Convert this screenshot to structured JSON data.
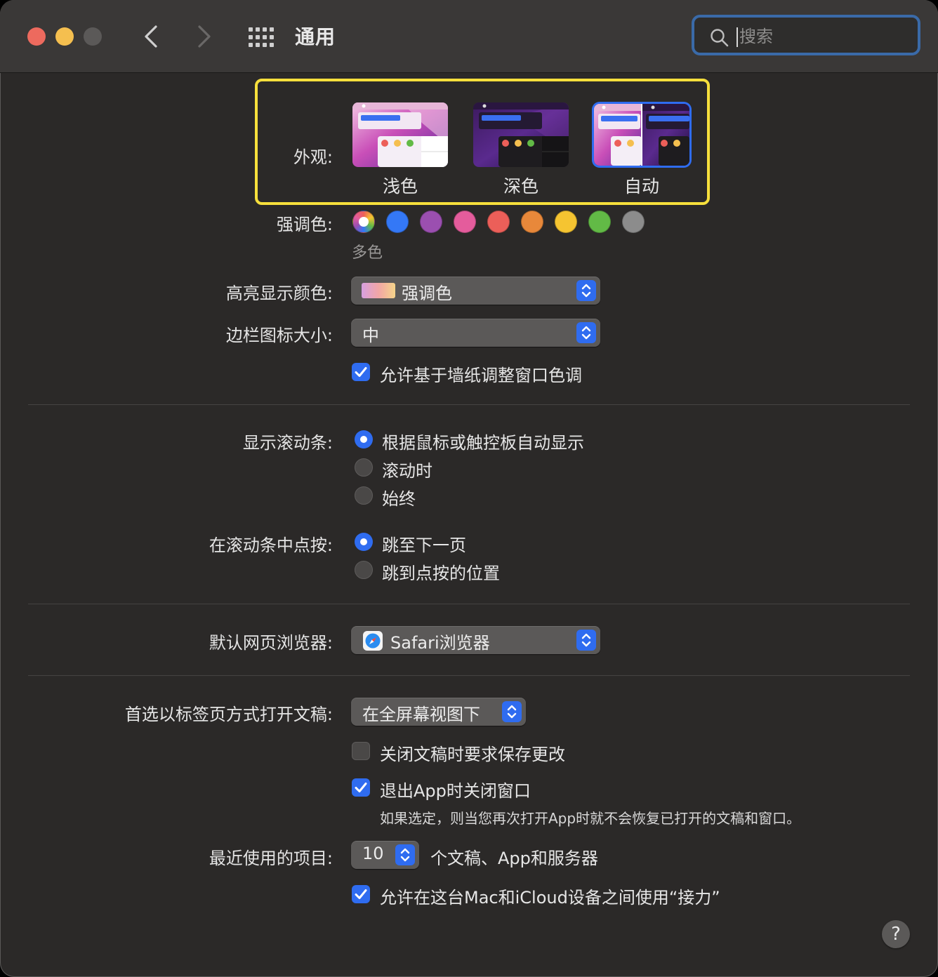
{
  "window": {
    "title": "通用"
  },
  "search": {
    "placeholder": "搜索",
    "value": ""
  },
  "appearance": {
    "label": "外观:",
    "options": [
      {
        "label": "浅色",
        "selected": false
      },
      {
        "label": "深色",
        "selected": false
      },
      {
        "label": "自动",
        "selected": true
      }
    ]
  },
  "accent": {
    "label": "强调色:",
    "selected_name": "多色",
    "colors": [
      "multicolor",
      "#3478f6",
      "#9b4fb0",
      "#e45c9c",
      "#ec5f59",
      "#e8883a",
      "#f5c431",
      "#62ba46",
      "#8c8c8c"
    ]
  },
  "highlight": {
    "label": "高亮显示颜色:",
    "value": "强调色"
  },
  "sidebar_icon": {
    "label": "边栏图标大小:",
    "value": "中"
  },
  "wallpaper_tint": {
    "label": "允许基于墙纸调整窗口色调",
    "checked": true
  },
  "scrollbars": {
    "label": "显示滚动条:",
    "options": [
      {
        "label": "根据鼠标或触控板自动显示",
        "selected": true
      },
      {
        "label": "滚动时",
        "selected": false
      },
      {
        "label": "始终",
        "selected": false
      }
    ]
  },
  "scroll_click": {
    "label": "在滚动条中点按:",
    "options": [
      {
        "label": "跳至下一页",
        "selected": true
      },
      {
        "label": "跳到点按的位置",
        "selected": false
      }
    ]
  },
  "browser": {
    "label": "默认网页浏览器:",
    "value": "Safari浏览器"
  },
  "tabs_pref": {
    "label": "首选以标签页方式打开文稿:",
    "value": "在全屏幕视图下"
  },
  "ask_save": {
    "label": "关闭文稿时要求保存更改",
    "checked": false
  },
  "close_windows": {
    "label": "退出App时关闭窗口",
    "checked": true,
    "note": "如果选定，则当您再次打开App时就不会恢复已打开的文稿和窗口。"
  },
  "recent_items": {
    "label": "最近使用的项目:",
    "value": "10",
    "suffix": "个文稿、App和服务器"
  },
  "handoff": {
    "label": "允许在这台Mac和iCloud设备之间使用“接力”",
    "checked": true
  },
  "help": {
    "label": "?"
  },
  "colors": {
    "accent_blue": "#2f6cf0",
    "highlight_yellow": "#f6df3c",
    "background": "#2b2928"
  }
}
